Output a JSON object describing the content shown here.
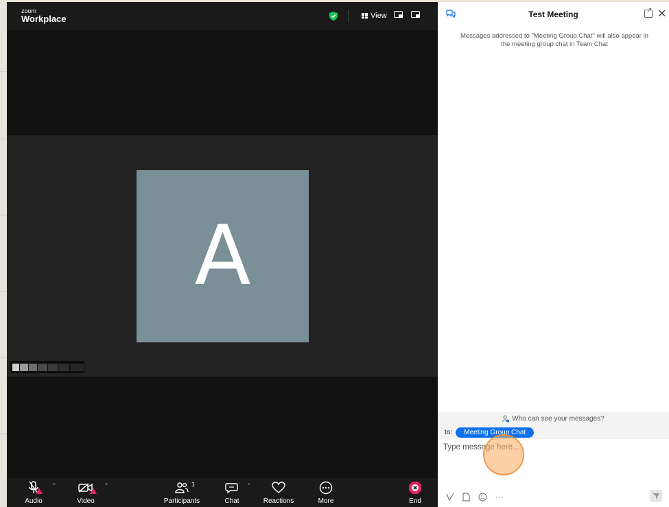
{
  "app": {
    "brand_small": "zoom",
    "brand_big": "Workplace",
    "view_label": "View"
  },
  "video": {
    "avatar_letter": "A",
    "avatar_color": "#7b8f99"
  },
  "toolbar": {
    "audio": "Audio",
    "video": "Video",
    "participants": "Participants",
    "participants_count": "1",
    "chat": "Chat",
    "reactions": "Reactions",
    "more": "More",
    "end": "End"
  },
  "chat_panel": {
    "title": "Test Meeting",
    "notice": "Messages addressed to \"Meeting Group Chat\" will also appear in the meeting group chat in Team Chat",
    "privacy": "Who can see your messages?",
    "to_label": "to:",
    "recipient": "Meeting Group Chat",
    "input_placeholder": "Type message here..."
  },
  "colors": {
    "accent": "#0e71eb",
    "alert": "#e0245e",
    "end": "#e0245e",
    "secure": "#22c55e"
  }
}
